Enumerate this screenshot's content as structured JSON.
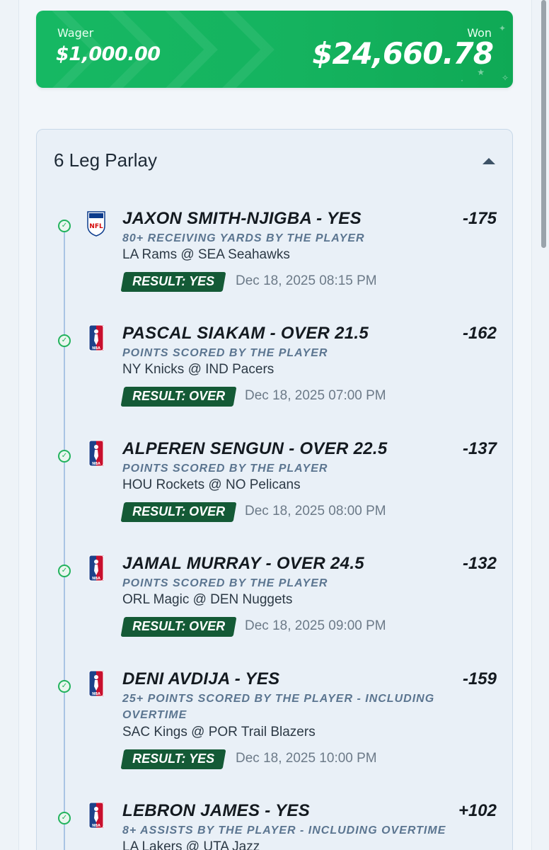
{
  "banner": {
    "wager_label": "Wager",
    "wager_amount": "$1,000.00",
    "won_label": "Won",
    "won_amount": "$24,660.78",
    "color": "#16b863"
  },
  "parlay": {
    "title": "6 Leg Parlay",
    "legs": [
      {
        "league_icon": "nfl-logo-icon",
        "player": "JAXON SMITH-NJIGBA - YES",
        "odds": "-175",
        "market": "80+ RECEIVING YARDS BY THE PLAYER",
        "matchup": "LA Rams @ SEA Seahawks",
        "result_label": "RESULT:",
        "result_value": "YES",
        "date": "Dec 18, 2025 08:15 PM"
      },
      {
        "league_icon": "nba-logo-icon",
        "player": "PASCAL SIAKAM - OVER 21.5",
        "odds": "-162",
        "market": "POINTS SCORED BY THE PLAYER",
        "matchup": "NY Knicks @ IND Pacers",
        "result_label": "RESULT:",
        "result_value": "OVER",
        "date": "Dec 18, 2025 07:00 PM"
      },
      {
        "league_icon": "nba-logo-icon",
        "player": "ALPEREN SENGUN - OVER 22.5",
        "odds": "-137",
        "market": "POINTS SCORED BY THE PLAYER",
        "matchup": "HOU Rockets @ NO Pelicans",
        "result_label": "RESULT:",
        "result_value": "OVER",
        "date": "Dec 18, 2025 08:00 PM"
      },
      {
        "league_icon": "nba-logo-icon",
        "player": "JAMAL MURRAY - OVER 24.5",
        "odds": "-132",
        "market": "POINTS SCORED BY THE PLAYER",
        "matchup": "ORL Magic @ DEN Nuggets",
        "result_label": "RESULT:",
        "result_value": "OVER",
        "date": "Dec 18, 2025 09:00 PM"
      },
      {
        "league_icon": "nba-logo-icon",
        "player": "DENI AVDIJA - YES",
        "odds": "-159",
        "market": "25+ POINTS SCORED BY THE PLAYER - INCLUDING OVERTIME",
        "matchup": "SAC Kings @ POR Trail Blazers",
        "result_label": "RESULT:",
        "result_value": "YES",
        "date": "Dec 18, 2025 10:00 PM"
      },
      {
        "league_icon": "nba-logo-icon",
        "player": "LEBRON JAMES - YES",
        "odds": "+102",
        "market": "8+ ASSISTS BY THE PLAYER - INCLUDING OVERTIME",
        "matchup": "LA Lakers @ UTA Jazz"
      }
    ]
  }
}
